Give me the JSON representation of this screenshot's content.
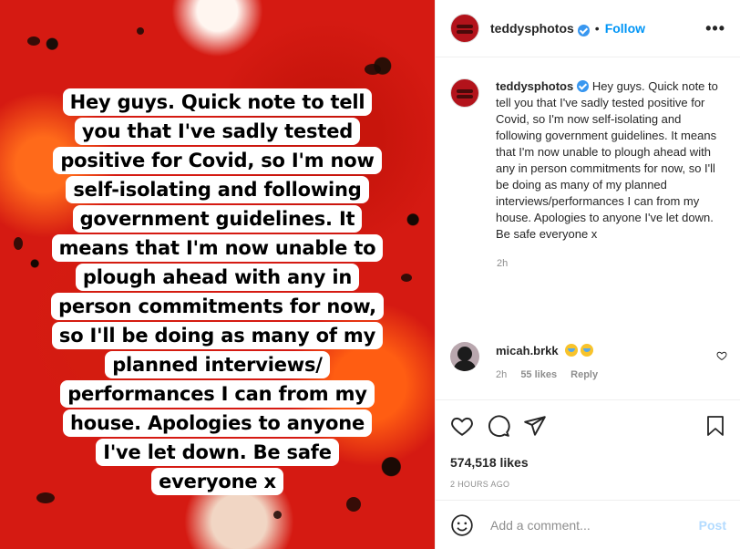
{
  "post": {
    "username": "teddysphotos",
    "follow_label": "Follow",
    "separator": "•",
    "more_label": "•••",
    "caption": "Hey guys. Quick note to tell you that I've sadly tested positive for Covid, so I'm now self-isolating and following government guidelines. It means that I'm now unable to plough ahead with any in person commitments for now, so I'll be doing as many of my planned interviews/performances I can from my house. Apologies to anyone I've let down. Be safe everyone x",
    "caption_age": "2h",
    "likes": "574,518 likes",
    "posted": "2 HOURS AGO"
  },
  "story_lines": [
    "Hey guys. Quick note to tell",
    "you that I've sadly tested",
    "positive for Covid, so I'm now",
    "self-isolating and following",
    "government guidelines. It",
    "means that I'm now unable to",
    "plough ahead with any in",
    "person commitments for now,",
    "so I'll be doing as many of my",
    "planned interviews/",
    "performances I can from my",
    "house. Apologies to anyone",
    "I've let down. Be safe",
    "everyone x"
  ],
  "comment": {
    "username": "micah.brkk",
    "age": "2h",
    "likes": "55 likes",
    "reply_label": "Reply"
  },
  "add_comment": {
    "placeholder": "Add a comment...",
    "post_label": "Post"
  },
  "colors": {
    "accent": "#0095f6",
    "post_disabled": "#b3dbff",
    "verified": "#3897f0",
    "media_base": "#d51a12"
  },
  "icons": [
    "heart-icon",
    "comment-icon",
    "share-icon",
    "bookmark-icon",
    "emoji-icon",
    "verified-badge-icon",
    "crying-emoji-icon"
  ]
}
